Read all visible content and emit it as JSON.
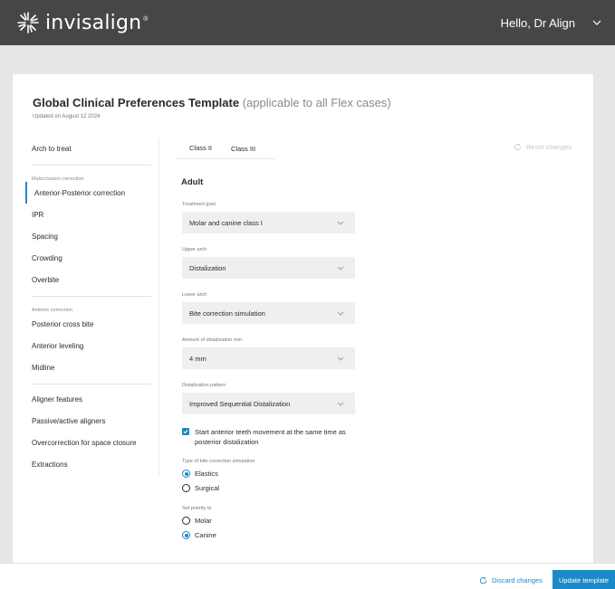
{
  "header": {
    "logo_text": "invisalign",
    "logo_reg": "®",
    "greeting": "Hello, Dr Align"
  },
  "page": {
    "title": "Global Clinical Preferences Template",
    "title_suffix": "(applicable to all Flex cases)",
    "updated": "Updated on August 12 2024"
  },
  "sidebar": {
    "arch_to_treat": "Arch to treat",
    "malocclusion_category": "Malocclusion correction",
    "malocclusion_items": [
      "Anterior-Posterior correction",
      "IPR",
      "Spacing",
      "Crowding",
      "Overbite"
    ],
    "anterior_category": "Anterior correction",
    "anterior_items": [
      "Posterior cross bite",
      "Anterior leveling",
      "Midline"
    ],
    "other_items": [
      "Aligner features",
      "Passive/active aligners",
      "Overcorrection for space closure",
      "Extractions"
    ]
  },
  "tabs": [
    "Class II",
    "Class III"
  ],
  "reset_label": "Reset changes",
  "form": {
    "section": "Adult",
    "treatment_goal": {
      "label": "Treatment goal",
      "value": "Molar and canine class I"
    },
    "upper_arch": {
      "label": "Upper arch",
      "value": "Distalization"
    },
    "lower_arch": {
      "label": "Lower arch",
      "value": "Bite correction simulation"
    },
    "distalization_amount": {
      "label": "Amount of distalization mm",
      "value": "4 mm"
    },
    "distalization_pattern": {
      "label": "Distalization pattern",
      "value": "Improved Sequential Distalization"
    },
    "checkbox_label": "Start anterior teeth movement at the same time as posterior distalization",
    "bite_type": {
      "label": "Type of bite correction simulation",
      "options": [
        "Elastics",
        "Surgical"
      ],
      "selected": "Elastics"
    },
    "priority": {
      "label": "Set priority to",
      "options": [
        "Molar",
        "Canine"
      ],
      "selected": "Canine"
    }
  },
  "footer": {
    "discard_label": "Discard changes",
    "update_label": "Update template"
  },
  "colors": {
    "accent": "#1c89c9",
    "header": "#464646"
  }
}
